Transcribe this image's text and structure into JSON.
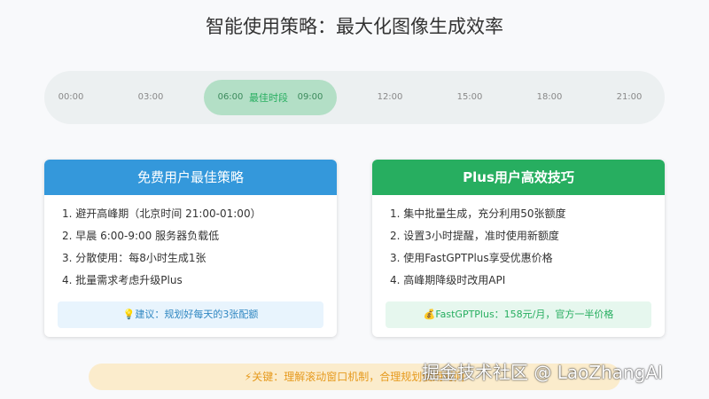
{
  "title": "智能使用策略：最大化图像生成效率",
  "timeline": {
    "ticks": [
      "00:00",
      "03:00",
      "06:00",
      "09:00",
      "12:00",
      "15:00",
      "18:00",
      "21:00"
    ],
    "best_label": "最佳时段"
  },
  "free": {
    "title": "免费用户最佳策略",
    "items": [
      "1. 避开高峰期（北京时间 21:00-01:00）",
      "2. 早晨 6:00-9:00 服务器负载低",
      "3. 分散使用：每8小时生成1张",
      "4. 批量需求考虑升级Plus"
    ],
    "tip": "建议：规划好每天的3张配额",
    "color": "#3498db"
  },
  "plus": {
    "title": "Plus用户高效技巧",
    "items": [
      "1. 集中批量生成，充分利用50张额度",
      "2. 设置3小时提醒，准时使用新额度",
      "3. 使用FastGPTPlus享受优惠价格",
      "4. 高峰期降级时改用API"
    ],
    "tip": "FastGPTPlus：158元/月，官方一半价格",
    "color": "#27ae60"
  },
  "key": "关键：理解滚动窗口机制，合理规划使用时间",
  "watermark": "掘金技术社区 @ LaoZhangAI"
}
